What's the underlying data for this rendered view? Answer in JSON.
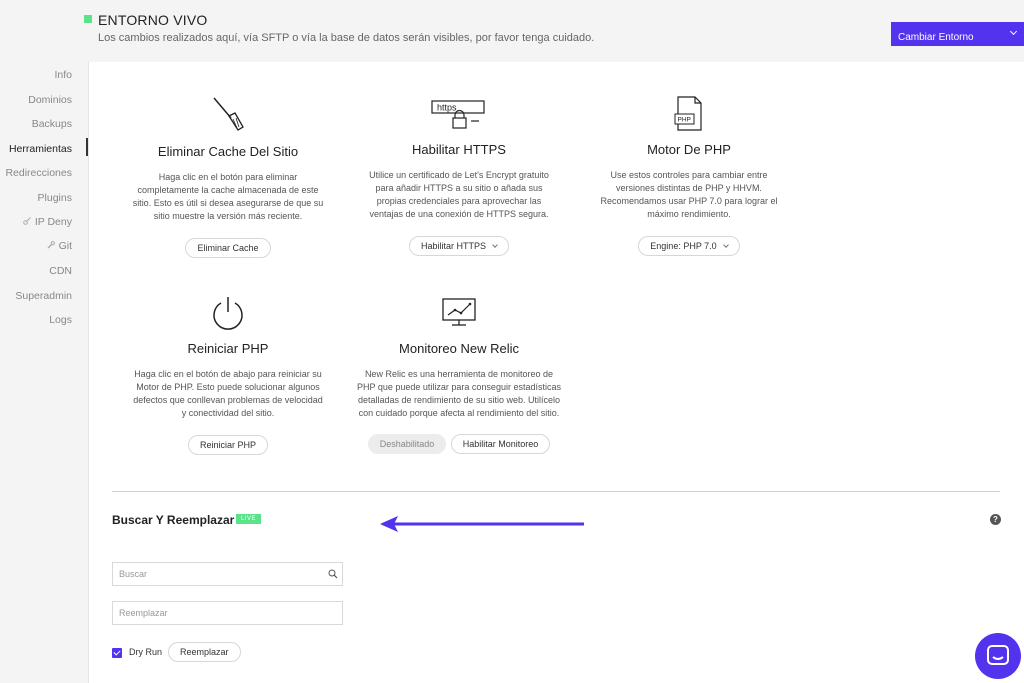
{
  "header": {
    "env_title": "ENTORNO VIVO",
    "env_subtitle": "Los cambios realizados aquí, vía SFTP o vía la base de datos serán visibles, por favor tenga cuidado.",
    "switch_label": "Cambiar Entorno"
  },
  "sidebar": {
    "items": [
      {
        "label": "Info"
      },
      {
        "label": "Dominios"
      },
      {
        "label": "Backups"
      },
      {
        "label": "Herramientas",
        "active": true
      },
      {
        "label": "Redirecciones"
      },
      {
        "label": "Plugins"
      },
      {
        "label": "IP Deny",
        "icon": "key-icon"
      },
      {
        "label": "Git",
        "icon": "wrench-icon"
      },
      {
        "label": "CDN"
      },
      {
        "label": "Superadmin"
      },
      {
        "label": "Logs"
      }
    ]
  },
  "tools": {
    "cache": {
      "icon": "broom-icon",
      "title": "Eliminar Cache Del Sitio",
      "desc": "Haga clic en el botón para eliminar completamente la cache almacenada de este sitio. Esto es útil si desea asegurarse de que su sitio muestre la versión más reciente.",
      "button": "Eliminar Cache"
    },
    "https": {
      "icon": "https-lock-icon",
      "icon_text": "https",
      "title": "Habilitar HTTPS",
      "desc": "Utilice un certificado de Let's Encrypt gratuito para añadir HTTPS a su sitio o añada sus propias credenciales para aprovechar las ventajas de una conexión de HTTPS segura.",
      "button": "Habilitar HTTPS"
    },
    "php": {
      "icon": "php-file-icon",
      "icon_text": "PHP",
      "title": "Motor De PHP",
      "desc": "Use estos controles para cambiar entre versiones distintas de PHP y HHVM. Recomendamos usar PHP 7.0 para lograr el máximo rendimiento.",
      "button": "Engine: PHP 7.0"
    },
    "restart": {
      "icon": "power-icon",
      "title": "Reiniciar PHP",
      "desc": "Haga clic en el botón de abajo para reiniciar su Motor de PHP. Esto puede solucionar algunos defectos que conllevan problemas de velocidad y conectividad del sitio.",
      "button": "Reiniciar PHP"
    },
    "newrelic": {
      "icon": "monitor-chart-icon",
      "title": "Monitoreo New Relic",
      "desc": "New Relic es una herramienta de monitoreo de PHP que puede utilizar para conseguir estadísticas detalladas de rendimiento de su sitio web. Utilícelo con cuidado porque afecta al rendimiento del sitio.",
      "status": "Deshabilitado",
      "button": "Habilitar Monitoreo"
    }
  },
  "search_replace": {
    "title": "Buscar Y Reemplazar",
    "badge": "LIVE",
    "help": "?",
    "search_placeholder": "Buscar",
    "replace_placeholder": "Reemplazar",
    "dry_run_label": "Dry Run",
    "dry_run_checked": true,
    "replace_button": "Reemplazar"
  },
  "colors": {
    "accent": "#5333ed",
    "live_green": "#5be38a"
  }
}
